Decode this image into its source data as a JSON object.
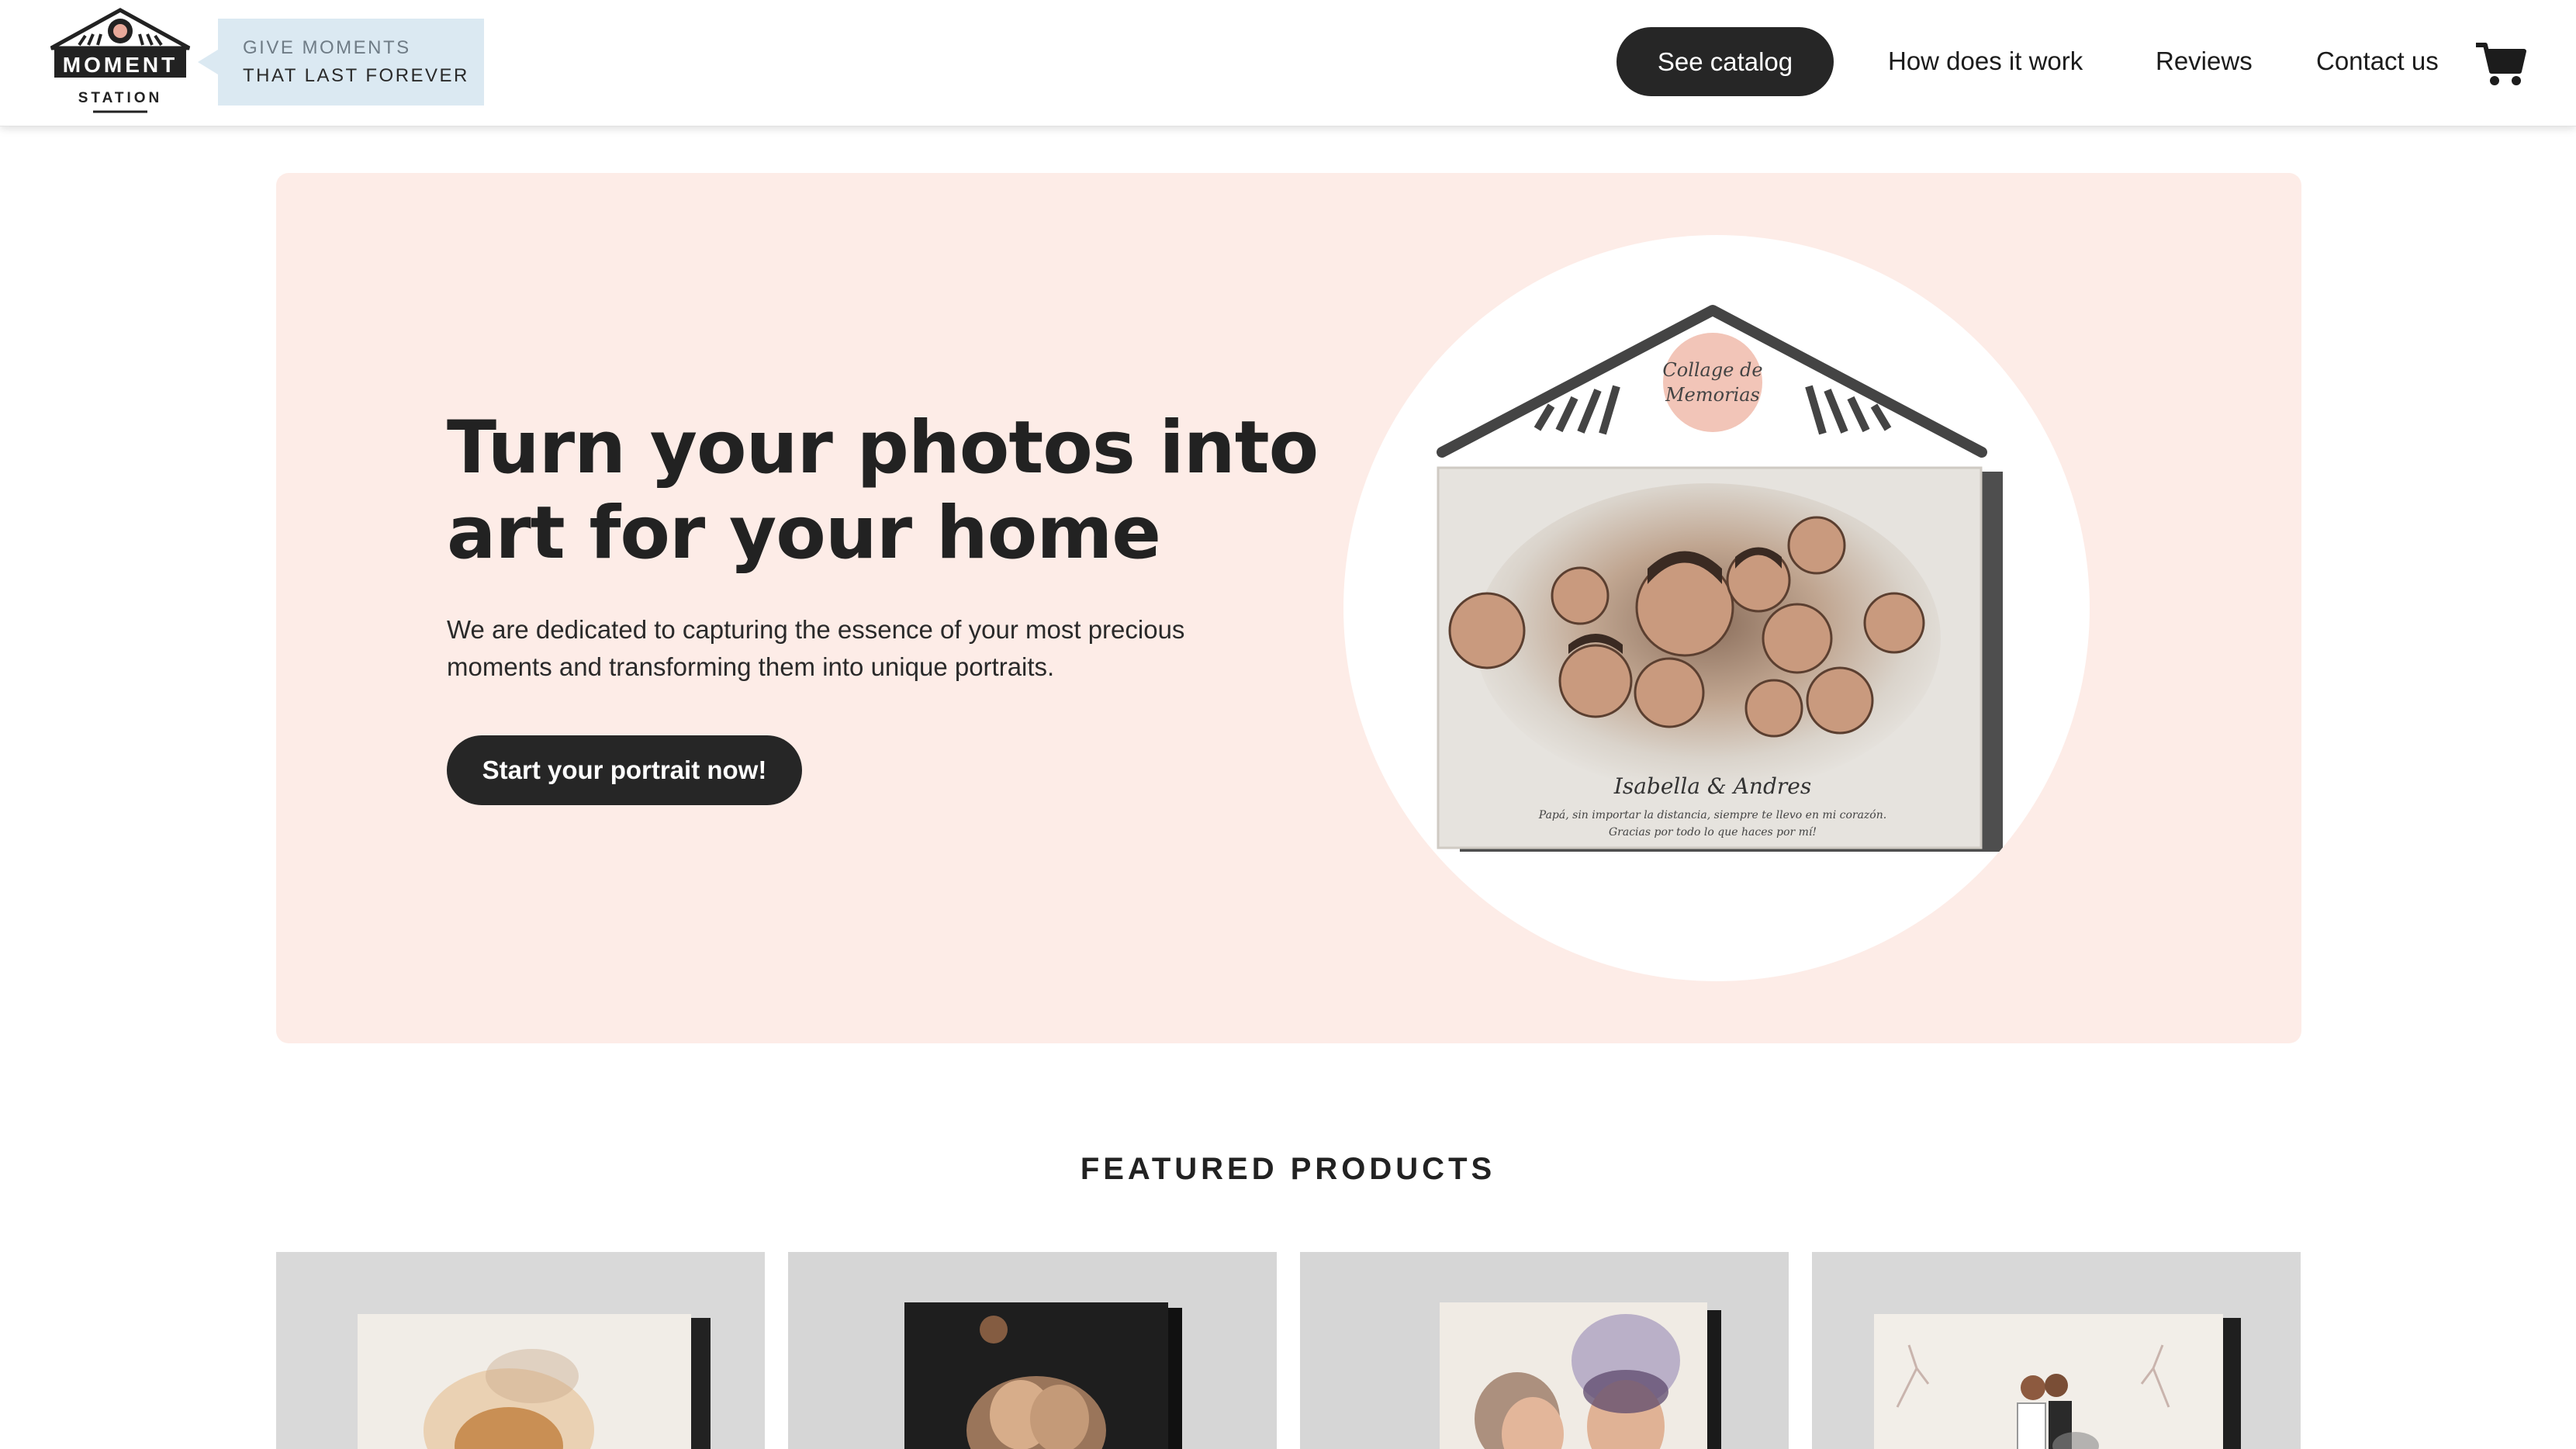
{
  "brand": {
    "name": "MOMENT",
    "sub": "STATION",
    "tagline_line1": "GIVE MOMENTS",
    "tagline_line2": "THAT LAST FOREVER"
  },
  "nav": {
    "catalog_label": "See catalog",
    "how_label": "How does it work",
    "reviews_label": "Reviews",
    "contact_label": "Contact us",
    "cart_icon": "shopping-cart-icon"
  },
  "hero": {
    "title": "Turn your photos into art for your home",
    "text": "We are dedicated to capturing the essence of your most precious moments and transforming them into unique portraits.",
    "button_label": "Start your portrait now!",
    "artwork": {
      "badge_line1": "Collage de",
      "badge_line2": "Memorias",
      "names": "Isabella & Andres",
      "caption_line1": "Papá, sin importar la distancia, siempre te llevo en mi corazón.",
      "caption_line2": "Gracias por todo lo que haces por mí!"
    }
  },
  "featured": {
    "title": "FEATURED PRODUCTS"
  },
  "colors": {
    "hero_bg": "#fdece7",
    "button_bg": "#262626",
    "tagline_bg": "#dbe9f2"
  }
}
